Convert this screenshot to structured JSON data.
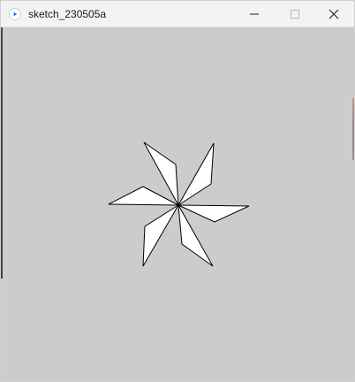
{
  "window": {
    "title": "sketch_230505a",
    "app_icon": "processing-app-icon",
    "controls": {
      "minimize_icon": "minimize-icon",
      "maximize_icon": "maximize-icon",
      "close_icon": "close-icon"
    }
  },
  "canvas": {
    "background": "#cccccc",
    "fill": "#ffffff",
    "stroke": "#000000",
    "shape_icon": "pinwheel-star"
  }
}
